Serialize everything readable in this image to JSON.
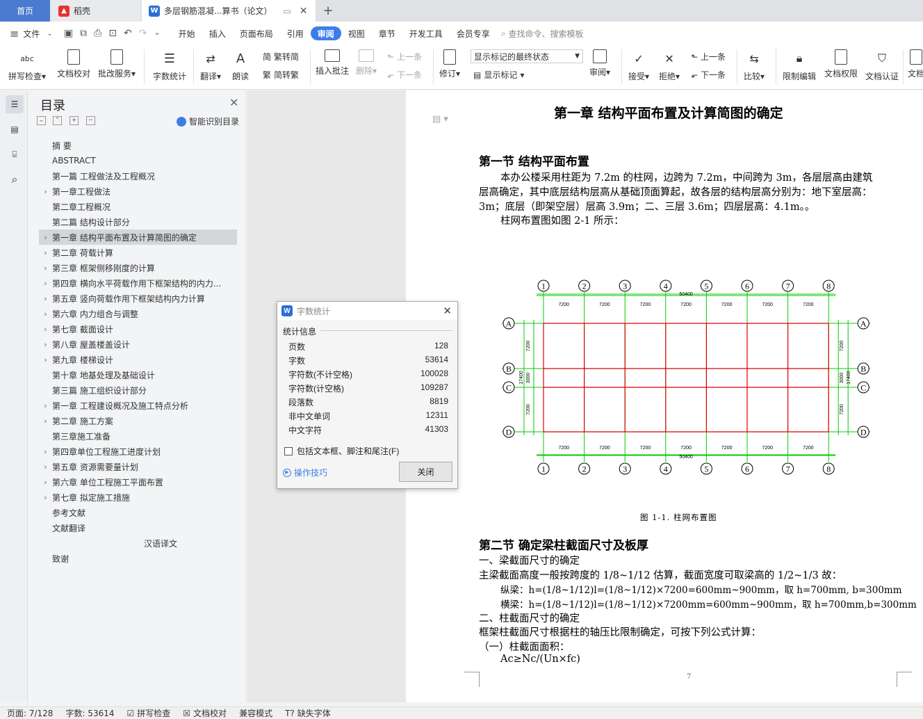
{
  "tabs": {
    "home": "首页",
    "daoke": "稻壳",
    "doc": "多层钢筋混凝...算书（论文）"
  },
  "menu": [
    "文件",
    "开始",
    "插入",
    "页面布局",
    "引用",
    "审阅",
    "视图",
    "章节",
    "开发工具",
    "会员专享"
  ],
  "search_placeholder": "查找命令、搜索模板",
  "ribbon": {
    "spell": "拼写检查",
    "proof": "文档校对",
    "batch": "批改服务",
    "wordcount": "字数统计",
    "translate": "翻译",
    "read": "朗读",
    "t2s": "繁转简",
    "s2t": "简转繁",
    "insert_comment": "插入批注",
    "delete": "删除",
    "prev": "上一条",
    "next": "下一条",
    "revise": "修订",
    "markup_state": "显示标记的最终状态",
    "show_markup": "显示标记",
    "review": "审阅",
    "accept": "接受",
    "reject": "拒绝",
    "prev2": "上一条",
    "next2": "下一条",
    "compare": "比较",
    "restrict": "限制编辑",
    "perm": "文档权限",
    "cert": "文档认证",
    "cut": "文档"
  },
  "toc": {
    "title": "目录",
    "smart": "智能识别目录",
    "items": [
      {
        "label": "摘  要",
        "arrow": false,
        "indent": 0
      },
      {
        "label": "ABSTRACT",
        "arrow": false,
        "indent": 0
      },
      {
        "label": "第一篇    工程做法及工程概况",
        "arrow": false,
        "indent": 0
      },
      {
        "label": "第一章工程做法",
        "arrow": true,
        "indent": 0
      },
      {
        "label": "第二章工程概况",
        "arrow": false,
        "indent": 0
      },
      {
        "label": "第二篇    结构设计部分",
        "arrow": false,
        "indent": 0
      },
      {
        "label": "第一章    结构平面布置及计算简图的确定",
        "arrow": true,
        "indent": 0,
        "selected": true
      },
      {
        "label": "第二章    荷载计算",
        "arrow": true,
        "indent": 0
      },
      {
        "label": "第三章    框架侧移刚度的计算",
        "arrow": true,
        "indent": 0
      },
      {
        "label": "第四章    横向水平荷载作用下框架结构的内力...",
        "arrow": true,
        "indent": 0
      },
      {
        "label": "第五章    竖向荷载作用下框架结构内力计算",
        "arrow": true,
        "indent": 0
      },
      {
        "label": "第六章    内力组合与调整",
        "arrow": true,
        "indent": 0
      },
      {
        "label": "第七章    截面设计",
        "arrow": true,
        "indent": 0
      },
      {
        "label": "第八章    屋盖楼盖设计",
        "arrow": true,
        "indent": 0
      },
      {
        "label": "第九章  楼梯设计",
        "arrow": true,
        "indent": 0
      },
      {
        "label": "第十章  地基处理及基础设计",
        "arrow": false,
        "indent": 0
      },
      {
        "label": "第三篇    施工组织设计部分",
        "arrow": false,
        "indent": 0
      },
      {
        "label": "第一章    工程建设概况及施工特点分析",
        "arrow": true,
        "indent": 0
      },
      {
        "label": "第二章    施工方案",
        "arrow": true,
        "indent": 0
      },
      {
        "label": "第三章施工准备",
        "arrow": false,
        "indent": 0
      },
      {
        "label": "第四章单位工程施工进度计划",
        "arrow": true,
        "indent": 0
      },
      {
        "label": "第五章    资源需要量计划",
        "arrow": true,
        "indent": 0
      },
      {
        "label": "第六章    单位工程施工平面布置",
        "arrow": true,
        "indent": 0
      },
      {
        "label": "第七章    拟定施工措施",
        "arrow": true,
        "indent": 0
      },
      {
        "label": "参考文献",
        "arrow": false,
        "indent": 0
      },
      {
        "label": "文献翻译",
        "arrow": false,
        "indent": 0
      },
      {
        "label": "汉语译文",
        "arrow": false,
        "indent": 1
      },
      {
        "label": "致谢",
        "arrow": false,
        "indent": 0
      }
    ]
  },
  "doc": {
    "chapter": "第一章    结构平面布置及计算简图的确定",
    "sec1": "第一节    结构平面布置",
    "p1": "本办公楼采用柱距为 7.2m 的柱网，边跨为 7.2m，中间跨为 3m，各层层高由建筑",
    "p2": "层高确定，其中底层结构层高从基础顶面算起，故各层的结构层高分别为：地下室层高：",
    "p3": "3m；底层（即架空层）层高 3.9m；二、三层 3.6m；四层层高：4.1m。。",
    "p4": "柱网布置图如图 2-1 所示：",
    "caption": "图 1-1. 柱网布置图",
    "sec2": "第二节    确定梁柱截面尺寸及板厚",
    "l1": "一、梁截面尺寸的确定",
    "l2": "主梁截面高度一般按跨度的 1/8~1/12 估算，截面宽度可取梁高的 1/2~1/3 故：",
    "l3": "纵梁：h=(1/8~1/12)l=(1/8~1/12)×7200=600mm~900mm，取 h=700mm, b=300mm",
    "l4": "横梁：h=(1/8~1/12)l=(1/8~1/12)×7200mm=600mm~900mm，取 h=700mm,b=300mm",
    "l5": "二、柱截面尺寸的确定",
    "l6": "框架柱截面尺寸根据柱的轴压比限制确定，可按下列公式计算：",
    "l7": "（一）柱截面面积：",
    "l8": "Ac≥Nc/(Un×fc)",
    "page_no": "7"
  },
  "grid": {
    "cols": [
      "1",
      "2",
      "3",
      "4",
      "5",
      "6",
      "7",
      "8"
    ],
    "rows": [
      "A",
      "B",
      "C",
      "D"
    ],
    "span": "7200",
    "total": "50400",
    "side_dims": [
      "7200",
      "3000",
      "7200"
    ],
    "side_total": "17400"
  },
  "dialog": {
    "title": "字数统计",
    "section": "统计信息",
    "rows": [
      {
        "k": "页数",
        "v": "128"
      },
      {
        "k": "字数",
        "v": "53614"
      },
      {
        "k": "字符数(不计空格)",
        "v": "100028"
      },
      {
        "k": "字符数(计空格)",
        "v": "109287"
      },
      {
        "k": "段落数",
        "v": "8819"
      },
      {
        "k": "非中文单词",
        "v": "12311"
      },
      {
        "k": "中文字符",
        "v": "41303"
      }
    ],
    "checkbox": "包括文本框、脚注和尾注(F)",
    "tips": "操作技巧",
    "close": "关闭"
  },
  "status": {
    "page": "页面: 7/128",
    "words": "字数: 53614",
    "spell": "拼写检查",
    "proof": "文档校对",
    "compat": "兼容模式",
    "font": "缺失字体"
  },
  "colors": {
    "accent": "#3c7ee7",
    "grid_green": "#00cc00",
    "grid_red": "#e00000"
  }
}
